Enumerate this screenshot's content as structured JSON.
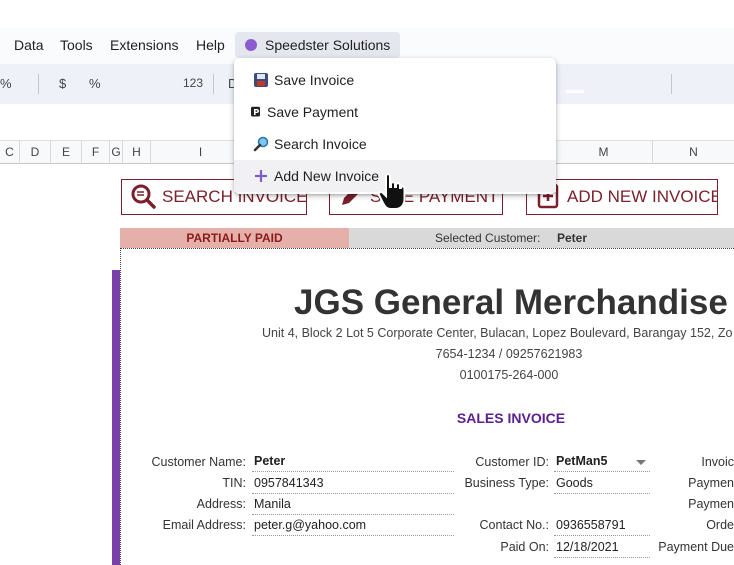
{
  "menu": {
    "items": [
      "Data",
      "Tools",
      "Extensions",
      "Help"
    ],
    "addon": "Speedster Solutions"
  },
  "toolbar": {
    "percent_left": "%",
    "currency": "$",
    "percent": "%",
    "number_format": "123",
    "font_initial": "D"
  },
  "columns": [
    "C",
    "D",
    "E",
    "F",
    "G",
    "H",
    "I",
    "M",
    "N"
  ],
  "dropdown": {
    "items": [
      {
        "label": "Save Invoice",
        "icon": "floppy-disk-icon"
      },
      {
        "label": "Save Payment",
        "icon": "parking-p-icon"
      },
      {
        "label": "Search Invoice",
        "icon": "magnifier-icon"
      },
      {
        "label": "Add New Invoice",
        "icon": "plus-icon"
      }
    ]
  },
  "actions": {
    "search": "SEARCH INVOICE",
    "payment": "SAVE PAYMENT",
    "add": "ADD NEW INVOICE"
  },
  "status": {
    "badge": "PARTIALLY PAID",
    "selected_label": "Selected Customer:",
    "selected_value": "Peter"
  },
  "invoice": {
    "company": "JGS General Merchandise",
    "address": "Unit 4, Block 2 Lot 5 Corporate Center, Bulacan, Lopez Boulevard, Barangay 152, Zo",
    "phones": "7654-1234 / 09257621983",
    "tin_number": "0100175-264-000",
    "title": "SALES INVOICE",
    "fields": {
      "customer_name_label": "Customer Name:",
      "customer_name": "Peter",
      "tin_label": "TIN:",
      "tin": "0957841343",
      "address_label": "Address:",
      "address": "Manila",
      "email_label": "Email Address:",
      "email": "peter.g@yahoo.com",
      "customer_id_label": "Customer ID:",
      "customer_id": "PetMan5",
      "business_type_label": "Business Type:",
      "business_type": "Goods",
      "contact_label": "Contact No.:",
      "contact": "0936558791",
      "paid_on_label": "Paid On:",
      "paid_on": "12/18/2021",
      "right1": "Invoic",
      "right2": "Paymen",
      "right3": "Paymen",
      "right4": "Orde",
      "right5": "Payment Due"
    }
  },
  "colors": {
    "accent_purple": "#7b3fa8",
    "button_maroon": "#7a1f2b",
    "status_paid_bg": "#e6b0aa"
  }
}
